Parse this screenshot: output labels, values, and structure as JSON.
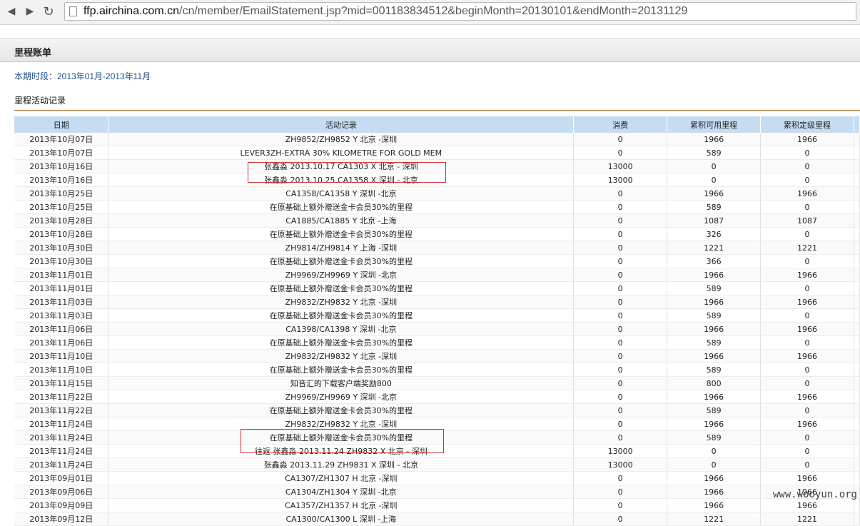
{
  "browser": {
    "back_icon": "◀",
    "forward_icon": "▶",
    "reload_icon": "↻",
    "url_host": "ffp.airchina.com.cn",
    "url_path": "/cn/member/EmailStatement.jsp?mid=001183834512&beginMonth=20130101&endMonth=20131129"
  },
  "page": {
    "header_title": "里程账单",
    "period_text": "本期时段：2013年01月-2013年11月",
    "records_title": "里程活动记录"
  },
  "table": {
    "headers": [
      "日期",
      "活动记录",
      "消费",
      "累积可用里程",
      "累积定级里程"
    ],
    "rows": [
      [
        "2013年10月07日",
        "ZH9852/ZH9852 Y 北京 -深圳",
        "0",
        "1966",
        "1966"
      ],
      [
        "2013年10月07日",
        "LEVER3ZH-EXTRA 30% KILOMETRE FOR GOLD MEM",
        "0",
        "589",
        "0"
      ],
      [
        "2013年10月16日",
        "张鑫淼 2013.10.17 CA1303 X 北京 - 深圳",
        "13000",
        "0",
        "0"
      ],
      [
        "2013年10月16日",
        "张鑫淼 2013.10.25 CA1358 X 深圳 - 北京",
        "13000",
        "0",
        "0"
      ],
      [
        "2013年10月25日",
        "CA1358/CA1358 Y 深圳 -北京",
        "0",
        "1966",
        "1966"
      ],
      [
        "2013年10月25日",
        "在原基础上额外赠送金卡会员30%的里程",
        "0",
        "589",
        "0"
      ],
      [
        "2013年10月28日",
        "CA1885/CA1885 Y 北京 -上海",
        "0",
        "1087",
        "1087"
      ],
      [
        "2013年10月28日",
        "在原基础上额外赠送金卡会员30%的里程",
        "0",
        "326",
        "0"
      ],
      [
        "2013年10月30日",
        "ZH9814/ZH9814 Y 上海 -深圳",
        "0",
        "1221",
        "1221"
      ],
      [
        "2013年10月30日",
        "在原基础上额外赠送金卡会员30%的里程",
        "0",
        "366",
        "0"
      ],
      [
        "2013年11月01日",
        "ZH9969/ZH9969 Y 深圳 -北京",
        "0",
        "1966",
        "1966"
      ],
      [
        "2013年11月01日",
        "在原基础上额外赠送金卡会员30%的里程",
        "0",
        "589",
        "0"
      ],
      [
        "2013年11月03日",
        "ZH9832/ZH9832 Y 北京 -深圳",
        "0",
        "1966",
        "1966"
      ],
      [
        "2013年11月03日",
        "在原基础上额外赠送金卡会员30%的里程",
        "0",
        "589",
        "0"
      ],
      [
        "2013年11月06日",
        "CA1398/CA1398 Y 深圳 -北京",
        "0",
        "1966",
        "1966"
      ],
      [
        "2013年11月06日",
        "在原基础上额外赠送金卡会员30%的里程",
        "0",
        "589",
        "0"
      ],
      [
        "2013年11月10日",
        "ZH9832/ZH9832 Y 北京 -深圳",
        "0",
        "1966",
        "1966"
      ],
      [
        "2013年11月10日",
        "在原基础上额外赠送金卡会员30%的里程",
        "0",
        "589",
        "0"
      ],
      [
        "2013年11月15日",
        "知音汇的下载客户端奖励800",
        "0",
        "800",
        "0"
      ],
      [
        "2013年11月22日",
        "ZH9969/ZH9969 Y 深圳 -北京",
        "0",
        "1966",
        "1966"
      ],
      [
        "2013年11月22日",
        "在原基础上额外赠送金卡会员30%的里程",
        "0",
        "589",
        "0"
      ],
      [
        "2013年11月24日",
        "ZH9832/ZH9832 Y 北京 -深圳",
        "0",
        "1966",
        "1966"
      ],
      [
        "2013年11月24日",
        "在原基础上额外赠送金卡会员30%的里程",
        "0",
        "589",
        "0"
      ],
      [
        "2013年11月24日",
        "往返 张鑫淼 2013.11.24 ZH9832 X 北京 - 深圳",
        "13000",
        "0",
        "0"
      ],
      [
        "2013年11月24日",
        "张鑫淼 2013.11.29 ZH9831 X 深圳 - 北京",
        "13000",
        "0",
        "0"
      ],
      [
        "2013年09月01日",
        "CA1307/ZH1307 H 北京 -深圳",
        "0",
        "1966",
        "1966"
      ],
      [
        "2013年09月06日",
        "CA1304/ZH1304 Y 深圳 -北京",
        "0",
        "1966",
        "1966"
      ],
      [
        "2013年09月09日",
        "CA1357/ZH1357 H 北京 -深圳",
        "0",
        "1966",
        "1966"
      ],
      [
        "2013年09月12日",
        "CA1300/CA1300 L 深圳 -上海",
        "0",
        "1221",
        "1221"
      ]
    ]
  },
  "watermark": "www.wooyun.org",
  "colors": {
    "header_bg": "#c6dcf0",
    "highlight_border": "#d32f2f",
    "period_text": "#1f4f8a",
    "divider": "#b5651d"
  }
}
